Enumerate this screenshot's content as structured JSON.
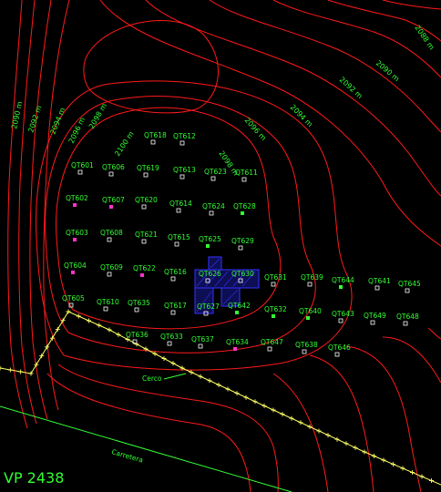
{
  "viewport_label": "VP  2438",
  "road_label": "Carretera",
  "fence_label": "Cerco",
  "colors": {
    "background": "#000000",
    "contour": "#ff1a1a",
    "text": "#33ff33",
    "fence": "#ffff66",
    "road": "#33ff33",
    "building": "#2222ff",
    "point_white": "#ffffff",
    "point_green": "#33ff33",
    "point_magenta": "#ff33cc"
  },
  "contour_labels": [
    "2090 m",
    "2092 m",
    "2094 m",
    "2096 m",
    "2098 m",
    "2100 m",
    "2098 m",
    "2096 m",
    "2094 m",
    "2092 m",
    "2090 m",
    "2088 m"
  ],
  "points": [
    {
      "id": "QT601",
      "marker": "white"
    },
    {
      "id": "QT602",
      "marker": "magenta"
    },
    {
      "id": "QT603",
      "marker": "magenta"
    },
    {
      "id": "QT604",
      "marker": "magenta"
    },
    {
      "id": "QT605",
      "marker": "white"
    },
    {
      "id": "QT606",
      "marker": "white"
    },
    {
      "id": "QT607",
      "marker": "magenta"
    },
    {
      "id": "QT608",
      "marker": "white"
    },
    {
      "id": "QT609",
      "marker": "white"
    },
    {
      "id": "QT610",
      "marker": "white"
    },
    {
      "id": "QT612",
      "marker": "white"
    },
    {
      "id": "QT613",
      "marker": "white"
    },
    {
      "id": "QT614",
      "marker": "white"
    },
    {
      "id": "QT615",
      "marker": "white"
    },
    {
      "id": "QT616",
      "marker": "white"
    },
    {
      "id": "QT617",
      "marker": "white"
    },
    {
      "id": "QT618",
      "marker": "white"
    },
    {
      "id": "QT619",
      "marker": "white"
    },
    {
      "id": "QT620",
      "marker": "white"
    },
    {
      "id": "QT621",
      "marker": "white"
    },
    {
      "id": "QT622",
      "marker": "magenta"
    },
    {
      "id": "QT623",
      "marker": "white"
    },
    {
      "id": "QT624",
      "marker": "white"
    },
    {
      "id": "QT625",
      "marker": "green"
    },
    {
      "id": "QT626",
      "marker": "white"
    },
    {
      "id": "QT627",
      "marker": "white"
    },
    {
      "id": "QT628",
      "marker": "green"
    },
    {
      "id": "QT629",
      "marker": "white"
    },
    {
      "id": "QT630",
      "marker": "white"
    },
    {
      "id": "QT631",
      "marker": "white"
    },
    {
      "id": "QT632",
      "marker": "green"
    },
    {
      "id": "QT633",
      "marker": "white"
    },
    {
      "id": "QT634",
      "marker": "magenta"
    },
    {
      "id": "QT635",
      "marker": "white"
    },
    {
      "id": "QT636",
      "marker": "white"
    },
    {
      "id": "QT637",
      "marker": "white"
    },
    {
      "id": "QT638",
      "marker": "white"
    },
    {
      "id": "QT639",
      "marker": "white"
    },
    {
      "id": "QT640",
      "marker": "green"
    },
    {
      "id": "QT641",
      "marker": "white"
    },
    {
      "id": "QT642",
      "marker": "green"
    },
    {
      "id": "QT643",
      "marker": "white"
    },
    {
      "id": "QT644",
      "marker": "green"
    },
    {
      "id": "QT645",
      "marker": "white"
    },
    {
      "id": "QT646",
      "marker": "white"
    },
    {
      "id": "QT647",
      "marker": "white"
    },
    {
      "id": "QT648",
      "marker": "white"
    },
    {
      "id": "QT649",
      "marker": "white"
    },
    {
      "id": "QT611",
      "marker": "white"
    }
  ]
}
